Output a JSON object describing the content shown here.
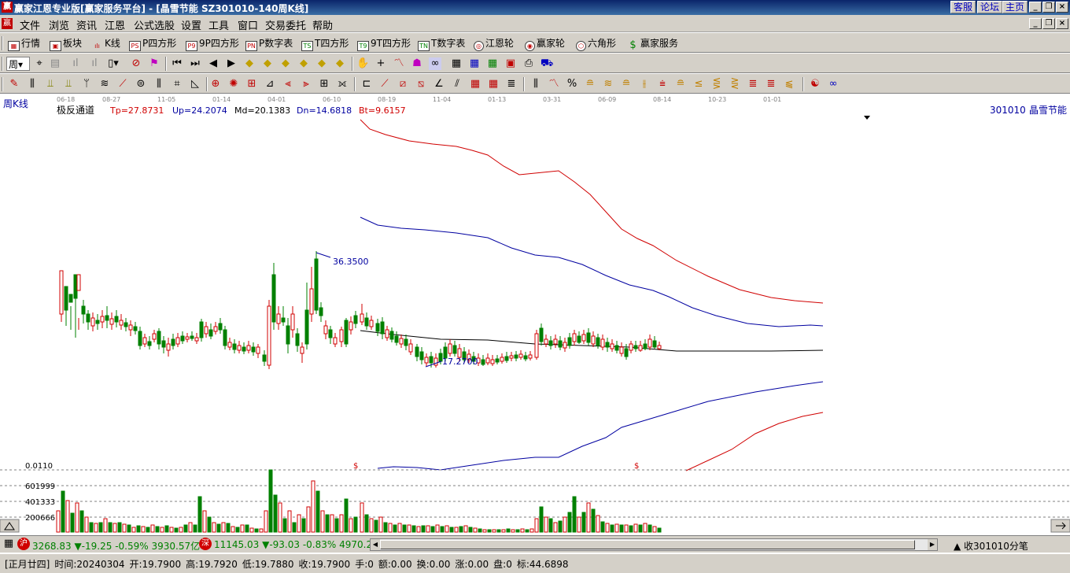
{
  "window": {
    "title": "赢家江恩专业版[赢家服务平台] - [晶雪节能   SZ301010-140周K线]",
    "links": [
      "客服",
      "论坛",
      "主页"
    ]
  },
  "menu": [
    "文件",
    "浏览",
    "资讯",
    "江恩",
    "公式选股",
    "设置",
    "工具",
    "窗口",
    "交易委托",
    "帮助"
  ],
  "toolbar1": [
    {
      "icon": "grid-icon",
      "label": "行情"
    },
    {
      "icon": "blocks-icon",
      "label": "板块"
    },
    {
      "icon": "candle-icon",
      "label": "K线"
    },
    {
      "icon": "PS",
      "label": "P四方形"
    },
    {
      "icon": "P9",
      "label": "9P四方形"
    },
    {
      "icon": "PN",
      "label": "P数字表"
    },
    {
      "icon": "TS",
      "label": "T四方形"
    },
    {
      "icon": "T9",
      "label": "9T四方形"
    },
    {
      "icon": "TN",
      "label": "T数字表"
    },
    {
      "icon": "wheel-icon",
      "label": "江恩轮"
    },
    {
      "icon": "wheel2-icon",
      "label": "赢家轮"
    },
    {
      "icon": "hexagon-icon",
      "label": "六角形"
    },
    {
      "icon": "dollar-icon",
      "label": "赢家服务"
    }
  ],
  "period_select": "周",
  "chart": {
    "period_label": "周K线",
    "date_ticks": [
      "06-18",
      "08-27",
      "11-05",
      "01-14",
      "04-01",
      "06-10",
      "08-19",
      "11-04",
      "01-13",
      "03-31",
      "06-09",
      "08-14",
      "10-23",
      "01-01"
    ],
    "indicator_name": "极反通道",
    "tp": "Tp=27.8731",
    "up": "Up=24.2074",
    "md": "Md=20.1383",
    "dn": "Dn=14.6818",
    "bt": "Bt=9.6157",
    "stock_code": "301010",
    "stock_name": "晶雪节能",
    "high_label": "36.3500",
    "low_label": "17.2700",
    "vol_axis": [
      "0.0110",
      "601999",
      "401333",
      "200666"
    ],
    "dollar_marks": [
      "$",
      "$"
    ],
    "colors": {
      "up": "#d00000",
      "down": "#008000",
      "mid": "#000000",
      "upper": "#d00000",
      "band": "#0000a0"
    }
  },
  "chart_data": {
    "type": "candlestick",
    "title": "",
    "high": 36.35,
    "low": 17.27,
    "series": [
      {
        "name": "Tp",
        "last": 27.8731
      },
      {
        "name": "Up",
        "last": 24.2074
      },
      {
        "name": "Md",
        "last": 20.1383
      },
      {
        "name": "Dn",
        "last": 14.6818
      },
      {
        "name": "Bt",
        "last": 9.6157
      }
    ]
  },
  "status": {
    "sh_label": "沪",
    "sh_index": "3268.83",
    "sh_change": "▼-19.25",
    "sh_pct": "-0.59%",
    "sh_amount": "3930.57亿",
    "sz_label": "深",
    "sz_index": "11145.03",
    "sz_change": "▼-93.03",
    "sz_pct": "-0.83%",
    "sz_amount": "4970.2",
    "right_text": "收301010分笔"
  },
  "info": {
    "lunar": "[正月廿四]",
    "time": "时间:20240304",
    "open": "开:19.7900",
    "high": "高:19.7920",
    "low": "低:19.7880",
    "close": "收:19.7900",
    "hand": "手:0",
    "amount": "额:0.00",
    "turnover": "换:0.00",
    "rise": "涨:0.00",
    "plate": "盘:0",
    "mark": "标:44.6898"
  }
}
